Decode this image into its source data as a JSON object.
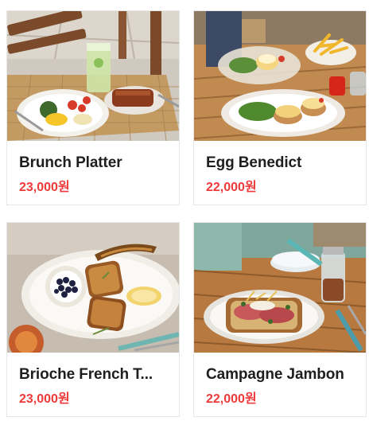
{
  "menu": {
    "items": [
      {
        "name": "Brunch Platter",
        "price": "23,000원"
      },
      {
        "name": "Egg Benedict",
        "price": "22,000원"
      },
      {
        "name": "Brioche French T...",
        "price": "23,000원"
      },
      {
        "name": "Campagne Jambon",
        "price": "22,000원"
      }
    ]
  },
  "colors": {
    "price": "#ee3a3a",
    "title": "#1e1e1e",
    "card_border": "#e6e6e6"
  }
}
